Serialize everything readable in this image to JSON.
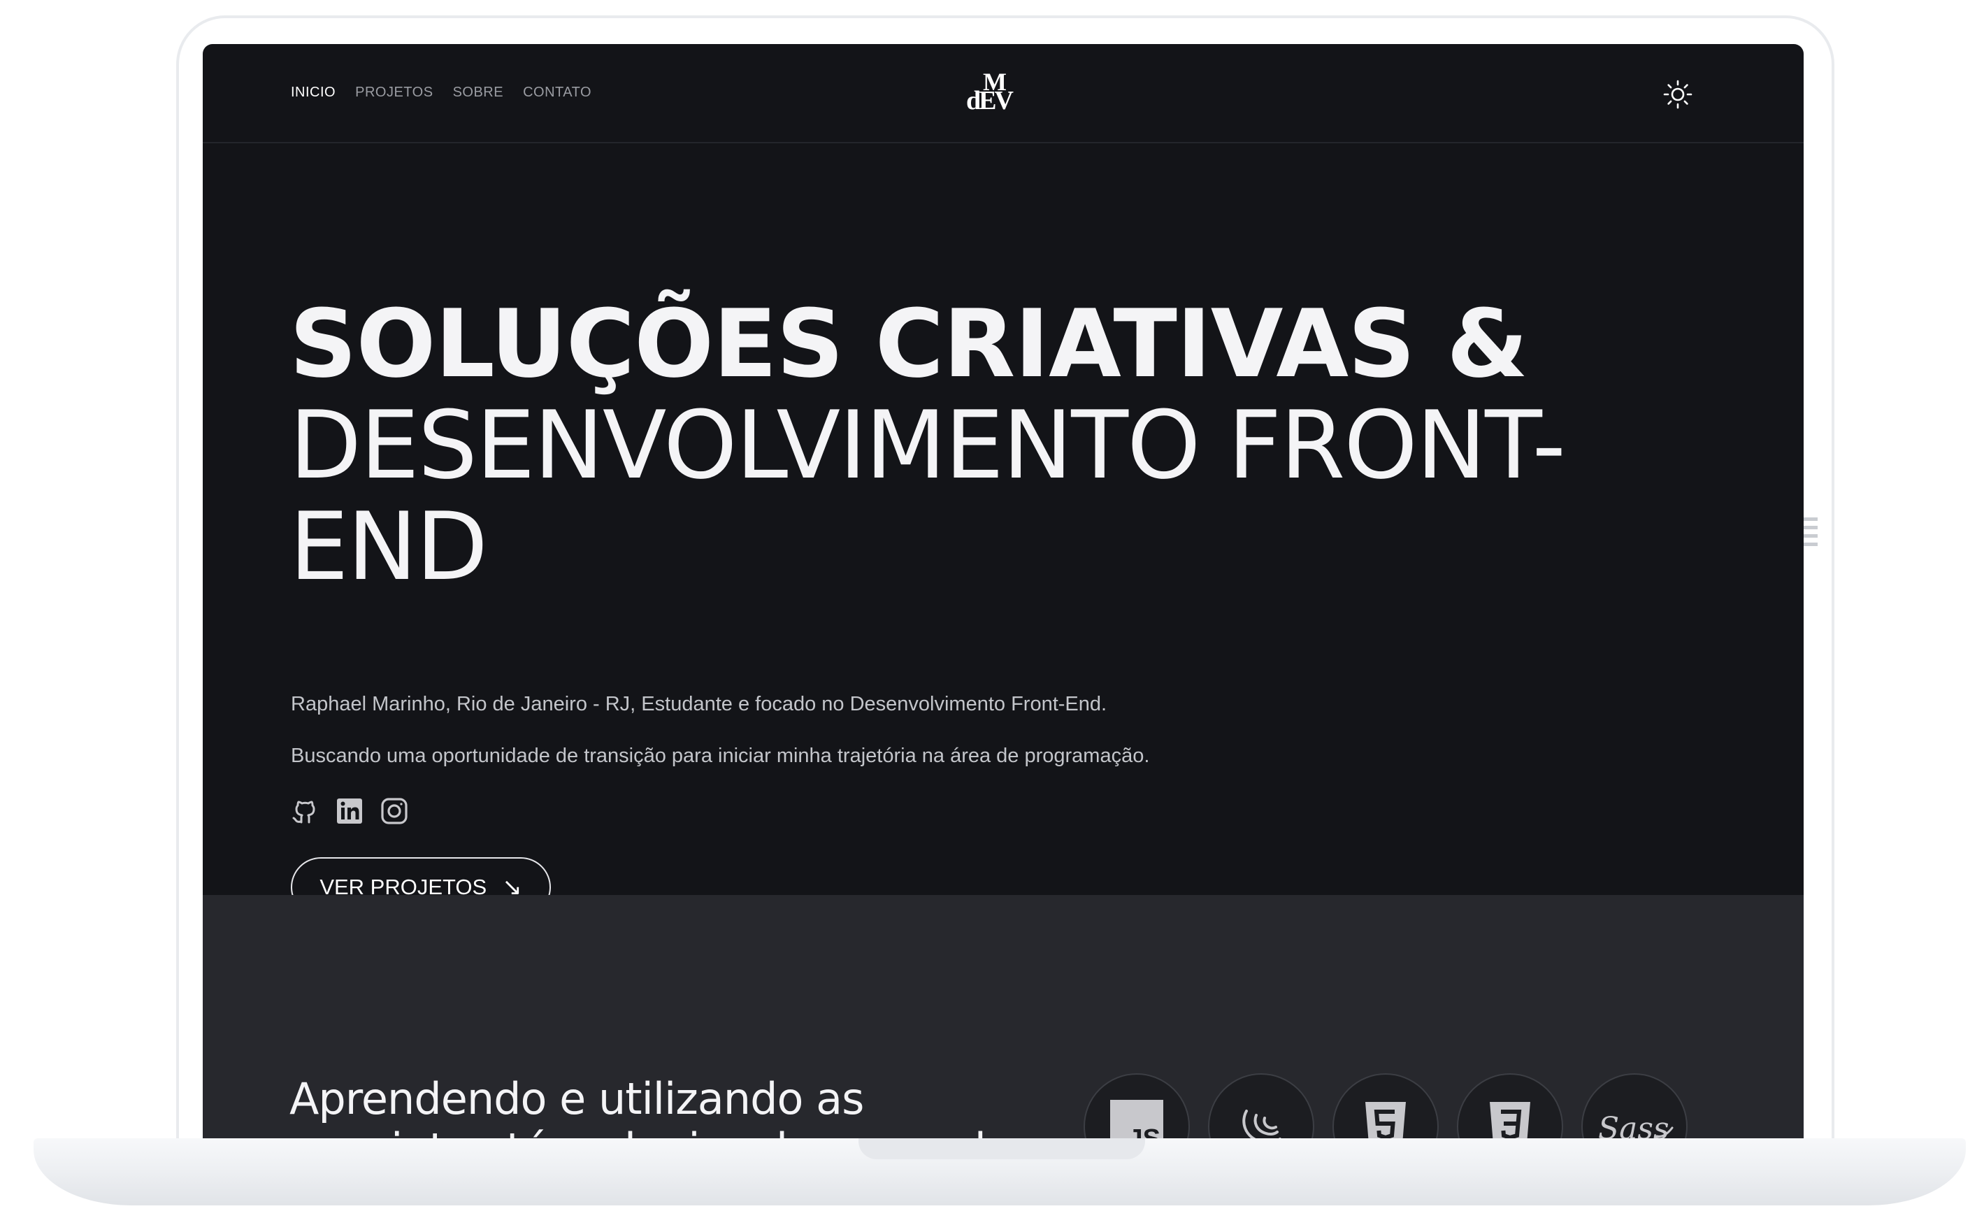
{
  "nav": {
    "items": [
      {
        "label": "INICIO",
        "active": true
      },
      {
        "label": "PROJETOS",
        "active": false
      },
      {
        "label": "SOBRE",
        "active": false
      },
      {
        "label": "CONTATO",
        "active": false
      }
    ]
  },
  "logo": {
    "top": "M",
    "bottom": "dEV"
  },
  "theme_toggle": {
    "icon": "sun-icon"
  },
  "hero": {
    "title_line1": "SOLUÇÕES CRIATIVAS &",
    "title_line2": "DESENVOLVIMENTO FRONT-",
    "title_line3": "END",
    "description": "Raphael Marinho, Rio de Janeiro - RJ, Estudante e focado no Desenvolvimento Front-End.",
    "description2": "Buscando uma oportunidade de transição para iniciar minha trajetória na área de programação.",
    "socials": [
      "github-icon",
      "linkedin-icon",
      "instagram-icon"
    ],
    "cta_label": "VER PROJETOS",
    "cta_arrow": "↘"
  },
  "tech": {
    "title_line1": "Aprendendo e utilizando as",
    "title_line2": "seguintes técnologias do mercado",
    "icons": [
      "javascript-icon",
      "jquery-icon",
      "html5-icon",
      "css3-icon",
      "sass-icon"
    ],
    "js_text": "JS",
    "sass_text": "Sass"
  },
  "colors": {
    "hero_bg": "#131418",
    "tech_bg": "#27282d",
    "text": "#f4f4f6",
    "muted": "#c3c5ca",
    "icon": "#c8c8cc"
  }
}
